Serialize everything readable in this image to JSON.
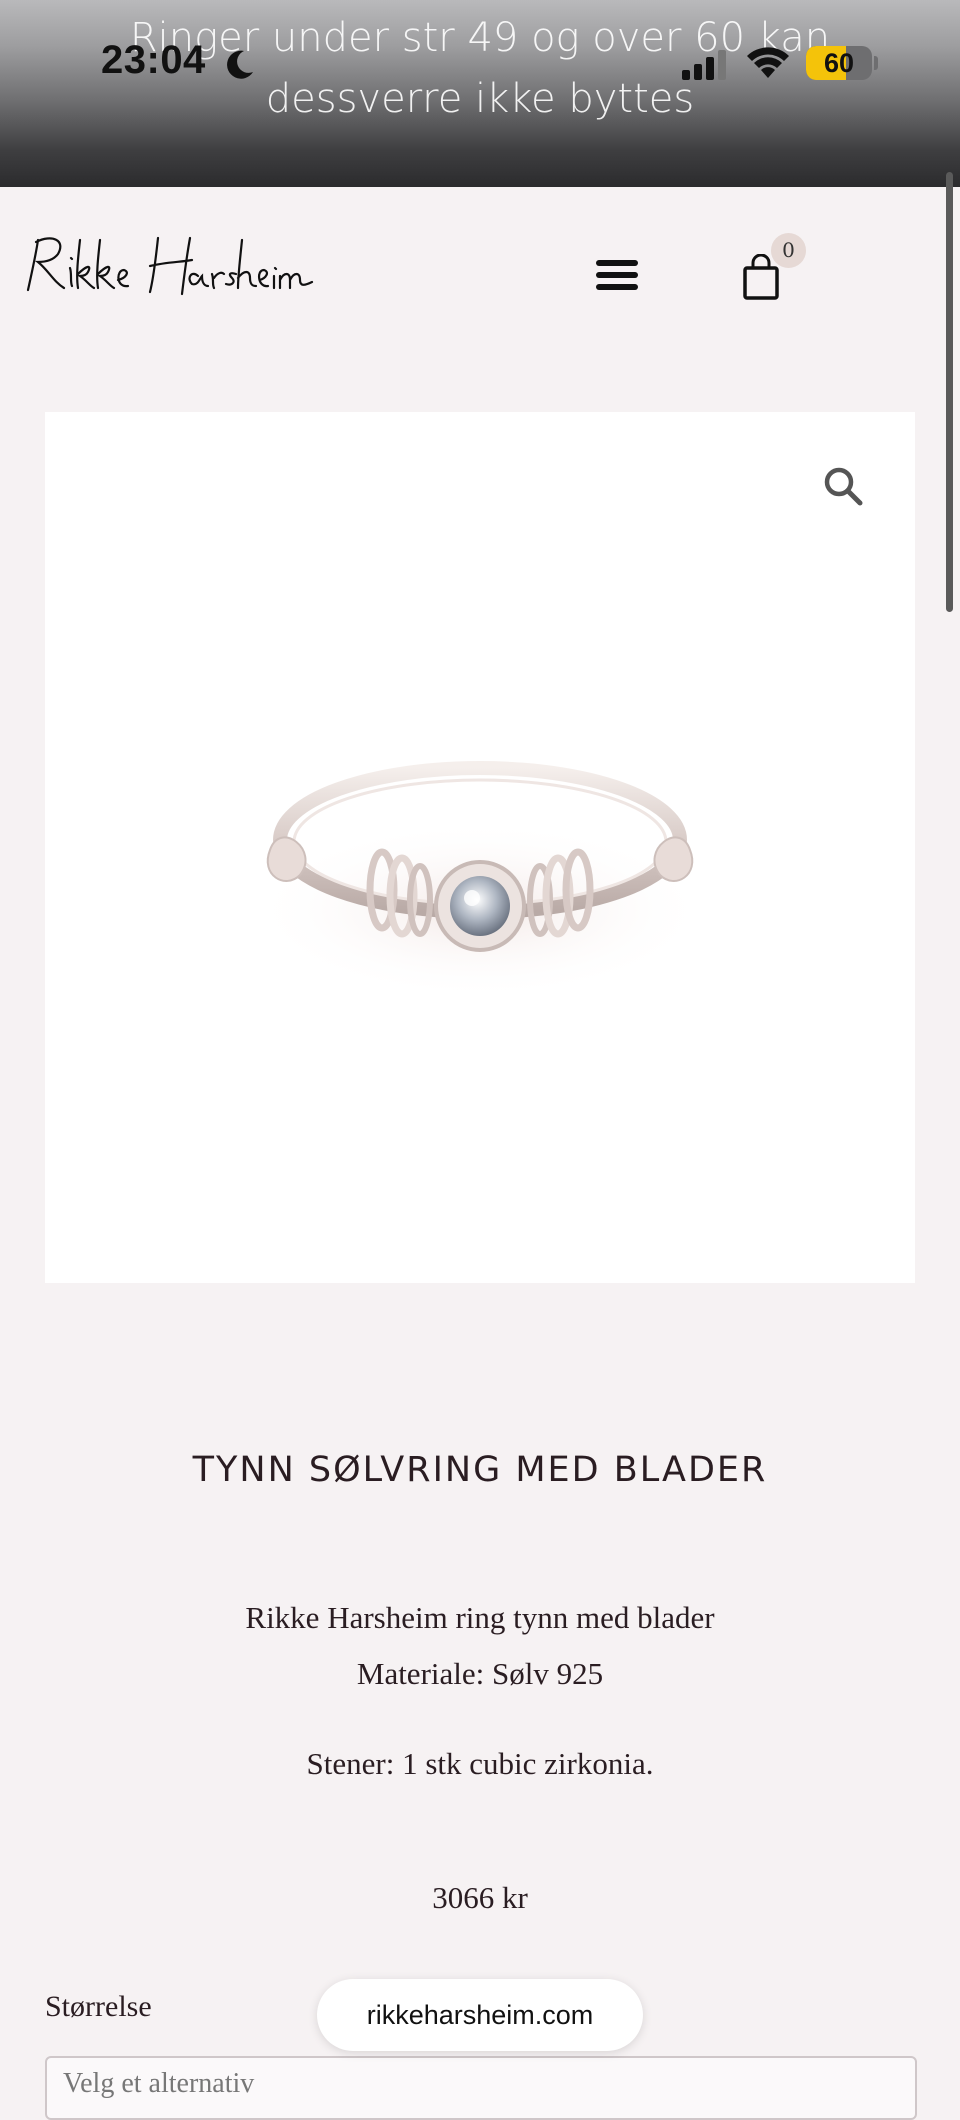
{
  "status_bar": {
    "time": "23:04",
    "battery_percent": 60,
    "battery_level": 0.6,
    "icons": [
      "moon-icon",
      "signal-icon",
      "wifi-icon",
      "battery-icon"
    ]
  },
  "banner": {
    "line1": "Ringer under str 49 og over 60 kan",
    "line2": "dessverre ikke byttes"
  },
  "header": {
    "logo_text": "Rikke Harsheim",
    "cart_count": "0"
  },
  "product": {
    "title": "TYNN SØLVRING MED BLADER",
    "description_line1": "Rikke Harsheim ring tynn med blader",
    "material": "Materiale: Sølv 925",
    "stones": "Stener: 1 stk cubic zirkonia.",
    "price": "3066 kr",
    "size_label": "Størrelse",
    "size_placeholder": "Velg et alternativ"
  },
  "browser": {
    "url": "rikkeharsheim.com"
  },
  "colors": {
    "page_bg": "#f6f2f3",
    "text": "#2a1d22",
    "battery": "#f4c30a",
    "cart_badge": "#e6d9d5"
  }
}
